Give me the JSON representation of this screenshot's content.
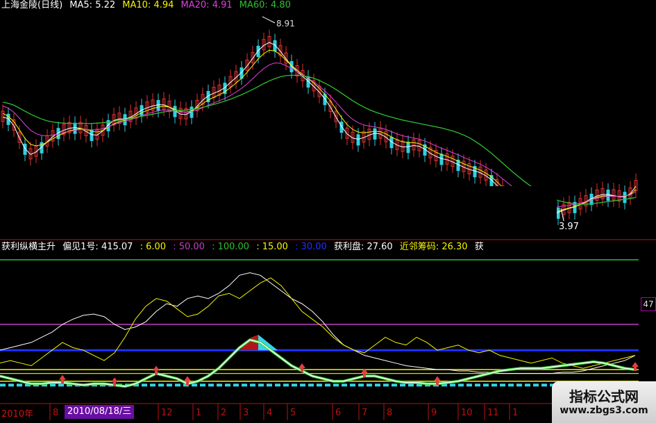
{
  "price_header": {
    "stock": "上海金陵(日线)",
    "ma": [
      {
        "label": "MA5: 5.22",
        "color": "#ffffff"
      },
      {
        "label": "MA10: 4.94",
        "color": "#f6f600"
      },
      {
        "label": "MA20: 4.91",
        "color": "#e040e0"
      },
      {
        "label": "MA60: 4.80",
        "color": "#30c030"
      }
    ]
  },
  "indicator_header": {
    "items": [
      {
        "label": "获利纵横主升",
        "color": "#ffffff"
      },
      {
        "label": "偏见1号: 415.07",
        "color": "#ffffff"
      },
      {
        "label": ": 6.00",
        "color": "#f6f600"
      },
      {
        "label": ": 50.00",
        "color": "#c040c0"
      },
      {
        "label": ": 100.00",
        "color": "#30c030"
      },
      {
        "label": ": 15.00",
        "color": "#f6f600"
      },
      {
        "label": ": 30.00",
        "color": "#2030ff"
      },
      {
        "label": "获利盘: 27.60",
        "color": "#ffffff"
      },
      {
        "label": "近邻筹码: 26.30",
        "color": "#f6f600"
      },
      {
        "label": "获",
        "color": "#ffffff"
      }
    ]
  },
  "annotations": {
    "high": "8.91",
    "low": "3.97",
    "right_tag": "47"
  },
  "date_axis": {
    "selected_date": "2010/08/18/三",
    "year_label": "2010年",
    "ticks": [
      "8",
      "12",
      "1",
      "2",
      "3",
      "4",
      "5",
      "6",
      "7",
      "8",
      "9",
      "10",
      "11",
      "1"
    ]
  },
  "watermark": {
    "name": "指标公式网",
    "url": "www.zbgs3.com"
  },
  "colors": {
    "up": "#e03030",
    "down": "#30d0e0",
    "ma5": "#ffffff",
    "ma10": "#f6f600",
    "ma20": "#e040e0",
    "ma60": "#30c030",
    "axis": "#c01010"
  },
  "chart_data": [
    {
      "type": "line",
      "title": "上海金陵(日线)",
      "candlestick": true,
      "ylim": [
        3.5,
        9.3
      ],
      "x": [
        0,
        8,
        16,
        24,
        32,
        40,
        48,
        56,
        64,
        72,
        80,
        88,
        96,
        104,
        112,
        120,
        128,
        136,
        144,
        152,
        160,
        168,
        176,
        184,
        192,
        200,
        208,
        216,
        224,
        232,
        240,
        248,
        256,
        264,
        272,
        280,
        288,
        296,
        304,
        312,
        320,
        328,
        336,
        344,
        352,
        360,
        368,
        376,
        384,
        392,
        400,
        408,
        416,
        424,
        432,
        440,
        448,
        456,
        464,
        472,
        480,
        488,
        496,
        504,
        512,
        520,
        528,
        536,
        544,
        552,
        560,
        568,
        576,
        584,
        592,
        600,
        608,
        616,
        624,
        632,
        640,
        648,
        656,
        664,
        672,
        680,
        688,
        696,
        704,
        712,
        720,
        728,
        736,
        744,
        752,
        760,
        768,
        776,
        784,
        792,
        800,
        808,
        816,
        824,
        832,
        840,
        848,
        856,
        864,
        872,
        880,
        888,
        896,
        904,
        912
      ],
      "series": [
        {
          "name": "MA5",
          "values": [
            6.5,
            6.46,
            6.27,
            5.94,
            5.66,
            5.5,
            5.57,
            5.7,
            5.84,
            5.98,
            6.08,
            6.15,
            6.2,
            6.22,
            6.2,
            6.12,
            6.03,
            6.02,
            6.13,
            6.29,
            6.41,
            6.45,
            6.45,
            6.5,
            6.59,
            6.69,
            6.75,
            6.8,
            6.83,
            6.83,
            6.77,
            6.67,
            6.58,
            6.57,
            6.65,
            6.79,
            6.95,
            7.07,
            7.14,
            7.2,
            7.29,
            7.43,
            7.56,
            7.7,
            7.87,
            8.07,
            8.28,
            8.42,
            8.5,
            8.43,
            8.26,
            8.06,
            7.87,
            7.72,
            7.59,
            7.46,
            7.32,
            7.17,
            6.99,
            6.77,
            6.5,
            6.25,
            6.05,
            5.94,
            5.91,
            5.95,
            6.02,
            6.07,
            6.05,
            5.96,
            5.84,
            5.75,
            5.7,
            5.71,
            5.74,
            5.72,
            5.64,
            5.53,
            5.45,
            5.39,
            5.36,
            5.3,
            5.23,
            5.16,
            5.1,
            5.06,
            5.01,
            4.93,
            4.82,
            4.67,
            4.5,
            4.35,
            4.2,
            4.04,
            3.9,
            3.8,
            3.75,
            3.75,
            3.8,
            3.87,
            3.95,
            4.01,
            4.06,
            4.1,
            4.16,
            4.24,
            4.32,
            4.39,
            4.43,
            4.43,
            4.4,
            4.37,
            4.37,
            4.45,
            4.65
          ]
        },
        {
          "name": "MA10",
          "values": [
            6.6,
            6.52,
            6.38,
            6.16,
            5.93,
            5.77,
            5.73,
            5.76,
            5.83,
            5.92,
            6.0,
            6.07,
            6.13,
            6.17,
            6.19,
            6.17,
            6.12,
            6.1,
            6.14,
            6.23,
            6.32,
            6.38,
            6.42,
            6.47,
            6.54,
            6.62,
            6.68,
            6.73,
            6.77,
            6.79,
            6.77,
            6.71,
            6.65,
            6.63,
            6.67,
            6.75,
            6.86,
            6.96,
            7.03,
            7.1,
            7.18,
            7.29,
            7.41,
            7.54,
            7.7,
            7.88,
            8.06,
            8.2,
            8.29,
            8.27,
            8.17,
            8.02,
            7.88,
            7.76,
            7.64,
            7.53,
            7.41,
            7.27,
            7.11,
            6.93,
            6.71,
            6.49,
            6.3,
            6.17,
            6.1,
            6.08,
            6.1,
            6.12,
            6.11,
            6.05,
            5.97,
            5.89,
            5.84,
            5.82,
            5.82,
            5.79,
            5.72,
            5.64,
            5.56,
            5.5,
            5.45,
            5.39,
            5.32,
            5.25,
            5.19,
            5.14,
            5.08,
            5.0,
            4.9,
            4.77,
            4.62,
            4.48,
            4.35,
            4.21,
            4.08,
            3.97,
            3.91,
            3.88,
            3.89,
            3.93,
            3.98,
            4.03,
            4.07,
            4.11,
            4.16,
            4.22,
            4.29,
            4.35,
            4.39,
            4.4,
            4.39,
            4.38,
            4.38,
            4.43,
            4.56
          ]
        },
        {
          "name": "MA20",
          "values": [
            6.8,
            6.74,
            6.63,
            6.47,
            6.3,
            6.15,
            6.06,
            6.01,
            6.0,
            6.02,
            6.05,
            6.09,
            6.12,
            6.15,
            6.17,
            6.17,
            6.16,
            6.16,
            6.19,
            6.24,
            6.3,
            6.35,
            6.39,
            6.43,
            6.48,
            6.54,
            6.59,
            6.63,
            6.67,
            6.69,
            6.69,
            6.67,
            6.64,
            6.63,
            6.65,
            6.69,
            6.75,
            6.82,
            6.88,
            6.94,
            7.0,
            7.08,
            7.17,
            7.27,
            7.39,
            7.53,
            7.67,
            7.8,
            7.9,
            7.95,
            7.94,
            7.88,
            7.8,
            7.72,
            7.63,
            7.54,
            7.44,
            7.33,
            7.2,
            7.06,
            6.9,
            6.73,
            6.57,
            6.44,
            6.35,
            6.29,
            6.26,
            6.24,
            6.21,
            6.17,
            6.11,
            6.05,
            6.0,
            5.97,
            5.94,
            5.91,
            5.86,
            5.8,
            5.73,
            5.67,
            5.61,
            5.55,
            5.49,
            5.42,
            5.36,
            5.3,
            5.24,
            5.16,
            5.07,
            4.97,
            4.85,
            4.73,
            4.61,
            4.49,
            4.37,
            4.27,
            4.19,
            4.13,
            4.1,
            4.09,
            4.1,
            4.12,
            4.14,
            4.17,
            4.2,
            4.24,
            4.29,
            4.33,
            4.36,
            4.38,
            4.38,
            4.38,
            4.39,
            4.42,
            4.5
          ]
        },
        {
          "name": "MA60",
          "values": [
            6.9,
            6.87,
            6.82,
            6.74,
            6.66,
            6.58,
            6.51,
            6.45,
            6.4,
            6.37,
            6.35,
            6.34,
            6.33,
            6.33,
            6.33,
            6.33,
            6.33,
            6.34,
            6.35,
            6.37,
            6.39,
            6.42,
            6.44,
            6.46,
            6.49,
            6.52,
            6.55,
            6.58,
            6.61,
            6.64,
            6.66,
            6.67,
            6.68,
            6.69,
            6.71,
            6.73,
            6.76,
            6.8,
            6.84,
            6.88,
            6.93,
            6.98,
            7.04,
            7.1,
            7.17,
            7.24,
            7.32,
            7.4,
            7.47,
            7.53,
            7.58,
            7.61,
            7.62,
            7.62,
            7.61,
            7.58,
            7.54,
            7.48,
            7.41,
            7.33,
            7.24,
            7.14,
            7.04,
            6.94,
            6.85,
            6.77,
            6.7,
            6.64,
            6.59,
            6.54,
            6.5,
            6.46,
            6.42,
            6.39,
            6.36,
            6.33,
            6.3,
            6.27,
            6.24,
            6.21,
            6.17,
            6.13,
            6.08,
            6.02,
            5.95,
            5.86,
            5.76,
            5.65,
            5.53,
            5.4,
            5.27,
            5.14,
            5.01,
            4.89,
            4.77,
            4.66,
            4.56,
            4.47,
            4.39,
            4.32,
            4.27,
            4.23,
            4.2,
            4.18,
            4.17,
            4.17,
            4.18,
            4.2,
            4.22,
            4.24,
            4.26,
            4.28,
            4.3,
            4.32,
            4.35
          ]
        }
      ],
      "annotations": [
        {
          "text": "8.91",
          "kind": "high"
        },
        {
          "text": "3.97",
          "kind": "low"
        }
      ]
    },
    {
      "type": "line",
      "title": "获利纵横主升",
      "ylim": [
        0,
        100
      ],
      "x": [
        0,
        15,
        30,
        45,
        60,
        75,
        90,
        105,
        120,
        135,
        150,
        165,
        180,
        195,
        210,
        225,
        240,
        255,
        270,
        285,
        300,
        315,
        330,
        345,
        360,
        375,
        390,
        405,
        420,
        435,
        450,
        465,
        480,
        495,
        510,
        525,
        540,
        555,
        570,
        585,
        600,
        615,
        630,
        645,
        660,
        675,
        690,
        705,
        720,
        735,
        750,
        765,
        780,
        795,
        810,
        825,
        840,
        855,
        870,
        885,
        900,
        915
      ],
      "reference_lines": [
        {
          "value": 100,
          "color": "#30c030"
        },
        {
          "value": 50,
          "color": "#c040c0"
        },
        {
          "value": 30,
          "color": "#2030ff"
        },
        {
          "value": 15,
          "color": "#f6f600"
        },
        {
          "value": 6,
          "color": "#f6f600"
        }
      ],
      "series": [
        {
          "name": "获利盘",
          "values": [
            30,
            32,
            34,
            36,
            40,
            44,
            50,
            54,
            57,
            58,
            56,
            50,
            46,
            48,
            52,
            60,
            66,
            64,
            70,
            72,
            70,
            74,
            80,
            88,
            90,
            88,
            82,
            76,
            70,
            66,
            60,
            52,
            42,
            34,
            30,
            26,
            24,
            22,
            20,
            18,
            17,
            16,
            15,
            15,
            14,
            14,
            13,
            13,
            12,
            12,
            12,
            12,
            12,
            12,
            13,
            13,
            14,
            16,
            18,
            20,
            22,
            26
          ]
        },
        {
          "name": "近邻筹码",
          "values": [
            20,
            22,
            20,
            18,
            24,
            30,
            36,
            32,
            30,
            26,
            22,
            28,
            40,
            54,
            64,
            70,
            68,
            62,
            56,
            58,
            64,
            72,
            74,
            70,
            76,
            82,
            86,
            80,
            70,
            60,
            54,
            48,
            40,
            34,
            30,
            28,
            34,
            40,
            36,
            34,
            40,
            36,
            30,
            32,
            34,
            30,
            28,
            30,
            26,
            24,
            22,
            20,
            22,
            24,
            20,
            18,
            16,
            18,
            20,
            22,
            24,
            26
          ]
        },
        {
          "name": "偏见1号",
          "values": [
            10,
            8,
            6,
            4,
            4,
            5,
            5,
            4,
            3,
            4,
            4,
            3,
            2,
            4,
            8,
            12,
            10,
            8,
            4,
            6,
            10,
            16,
            24,
            32,
            38,
            36,
            30,
            24,
            18,
            14,
            10,
            8,
            6,
            6,
            8,
            10,
            10,
            8,
            6,
            5,
            5,
            4,
            4,
            5,
            6,
            8,
            10,
            12,
            14,
            15,
            16,
            16,
            16,
            17,
            18,
            19,
            20,
            21,
            20,
            18,
            16,
            15
          ]
        }
      ]
    }
  ]
}
